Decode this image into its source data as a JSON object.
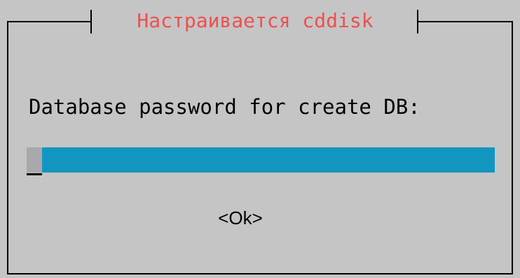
{
  "dialog": {
    "title": "Настраивается cddisk",
    "prompt": "Database password for create DB:",
    "password_value": "",
    "ok_label": "<Ok>"
  },
  "colors": {
    "background": "#c5c5c5",
    "title": "#ef4f4f",
    "input_field": "#1296c0",
    "cursor": "#a8a8ad",
    "frame": "#000000"
  }
}
